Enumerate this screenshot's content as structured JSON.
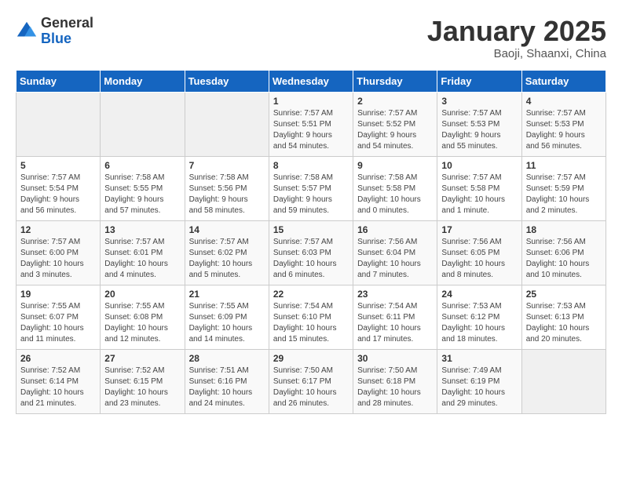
{
  "logo": {
    "general": "General",
    "blue": "Blue"
  },
  "header": {
    "month": "January 2025",
    "location": "Baoji, Shaanxi, China"
  },
  "weekdays": [
    "Sunday",
    "Monday",
    "Tuesday",
    "Wednesday",
    "Thursday",
    "Friday",
    "Saturday"
  ],
  "weeks": [
    [
      {
        "day": "",
        "content": ""
      },
      {
        "day": "",
        "content": ""
      },
      {
        "day": "",
        "content": ""
      },
      {
        "day": "1",
        "content": "Sunrise: 7:57 AM\nSunset: 5:51 PM\nDaylight: 9 hours\nand 54 minutes."
      },
      {
        "day": "2",
        "content": "Sunrise: 7:57 AM\nSunset: 5:52 PM\nDaylight: 9 hours\nand 54 minutes."
      },
      {
        "day": "3",
        "content": "Sunrise: 7:57 AM\nSunset: 5:53 PM\nDaylight: 9 hours\nand 55 minutes."
      },
      {
        "day": "4",
        "content": "Sunrise: 7:57 AM\nSunset: 5:53 PM\nDaylight: 9 hours\nand 56 minutes."
      }
    ],
    [
      {
        "day": "5",
        "content": "Sunrise: 7:57 AM\nSunset: 5:54 PM\nDaylight: 9 hours\nand 56 minutes."
      },
      {
        "day": "6",
        "content": "Sunrise: 7:58 AM\nSunset: 5:55 PM\nDaylight: 9 hours\nand 57 minutes."
      },
      {
        "day": "7",
        "content": "Sunrise: 7:58 AM\nSunset: 5:56 PM\nDaylight: 9 hours\nand 58 minutes."
      },
      {
        "day": "8",
        "content": "Sunrise: 7:58 AM\nSunset: 5:57 PM\nDaylight: 9 hours\nand 59 minutes."
      },
      {
        "day": "9",
        "content": "Sunrise: 7:58 AM\nSunset: 5:58 PM\nDaylight: 10 hours\nand 0 minutes."
      },
      {
        "day": "10",
        "content": "Sunrise: 7:57 AM\nSunset: 5:58 PM\nDaylight: 10 hours\nand 1 minute."
      },
      {
        "day": "11",
        "content": "Sunrise: 7:57 AM\nSunset: 5:59 PM\nDaylight: 10 hours\nand 2 minutes."
      }
    ],
    [
      {
        "day": "12",
        "content": "Sunrise: 7:57 AM\nSunset: 6:00 PM\nDaylight: 10 hours\nand 3 minutes."
      },
      {
        "day": "13",
        "content": "Sunrise: 7:57 AM\nSunset: 6:01 PM\nDaylight: 10 hours\nand 4 minutes."
      },
      {
        "day": "14",
        "content": "Sunrise: 7:57 AM\nSunset: 6:02 PM\nDaylight: 10 hours\nand 5 minutes."
      },
      {
        "day": "15",
        "content": "Sunrise: 7:57 AM\nSunset: 6:03 PM\nDaylight: 10 hours\nand 6 minutes."
      },
      {
        "day": "16",
        "content": "Sunrise: 7:56 AM\nSunset: 6:04 PM\nDaylight: 10 hours\nand 7 minutes."
      },
      {
        "day": "17",
        "content": "Sunrise: 7:56 AM\nSunset: 6:05 PM\nDaylight: 10 hours\nand 8 minutes."
      },
      {
        "day": "18",
        "content": "Sunrise: 7:56 AM\nSunset: 6:06 PM\nDaylight: 10 hours\nand 10 minutes."
      }
    ],
    [
      {
        "day": "19",
        "content": "Sunrise: 7:55 AM\nSunset: 6:07 PM\nDaylight: 10 hours\nand 11 minutes."
      },
      {
        "day": "20",
        "content": "Sunrise: 7:55 AM\nSunset: 6:08 PM\nDaylight: 10 hours\nand 12 minutes."
      },
      {
        "day": "21",
        "content": "Sunrise: 7:55 AM\nSunset: 6:09 PM\nDaylight: 10 hours\nand 14 minutes."
      },
      {
        "day": "22",
        "content": "Sunrise: 7:54 AM\nSunset: 6:10 PM\nDaylight: 10 hours\nand 15 minutes."
      },
      {
        "day": "23",
        "content": "Sunrise: 7:54 AM\nSunset: 6:11 PM\nDaylight: 10 hours\nand 17 minutes."
      },
      {
        "day": "24",
        "content": "Sunrise: 7:53 AM\nSunset: 6:12 PM\nDaylight: 10 hours\nand 18 minutes."
      },
      {
        "day": "25",
        "content": "Sunrise: 7:53 AM\nSunset: 6:13 PM\nDaylight: 10 hours\nand 20 minutes."
      }
    ],
    [
      {
        "day": "26",
        "content": "Sunrise: 7:52 AM\nSunset: 6:14 PM\nDaylight: 10 hours\nand 21 minutes."
      },
      {
        "day": "27",
        "content": "Sunrise: 7:52 AM\nSunset: 6:15 PM\nDaylight: 10 hours\nand 23 minutes."
      },
      {
        "day": "28",
        "content": "Sunrise: 7:51 AM\nSunset: 6:16 PM\nDaylight: 10 hours\nand 24 minutes."
      },
      {
        "day": "29",
        "content": "Sunrise: 7:50 AM\nSunset: 6:17 PM\nDaylight: 10 hours\nand 26 minutes."
      },
      {
        "day": "30",
        "content": "Sunrise: 7:50 AM\nSunset: 6:18 PM\nDaylight: 10 hours\nand 28 minutes."
      },
      {
        "day": "31",
        "content": "Sunrise: 7:49 AM\nSunset: 6:19 PM\nDaylight: 10 hours\nand 29 minutes."
      },
      {
        "day": "",
        "content": ""
      }
    ]
  ]
}
